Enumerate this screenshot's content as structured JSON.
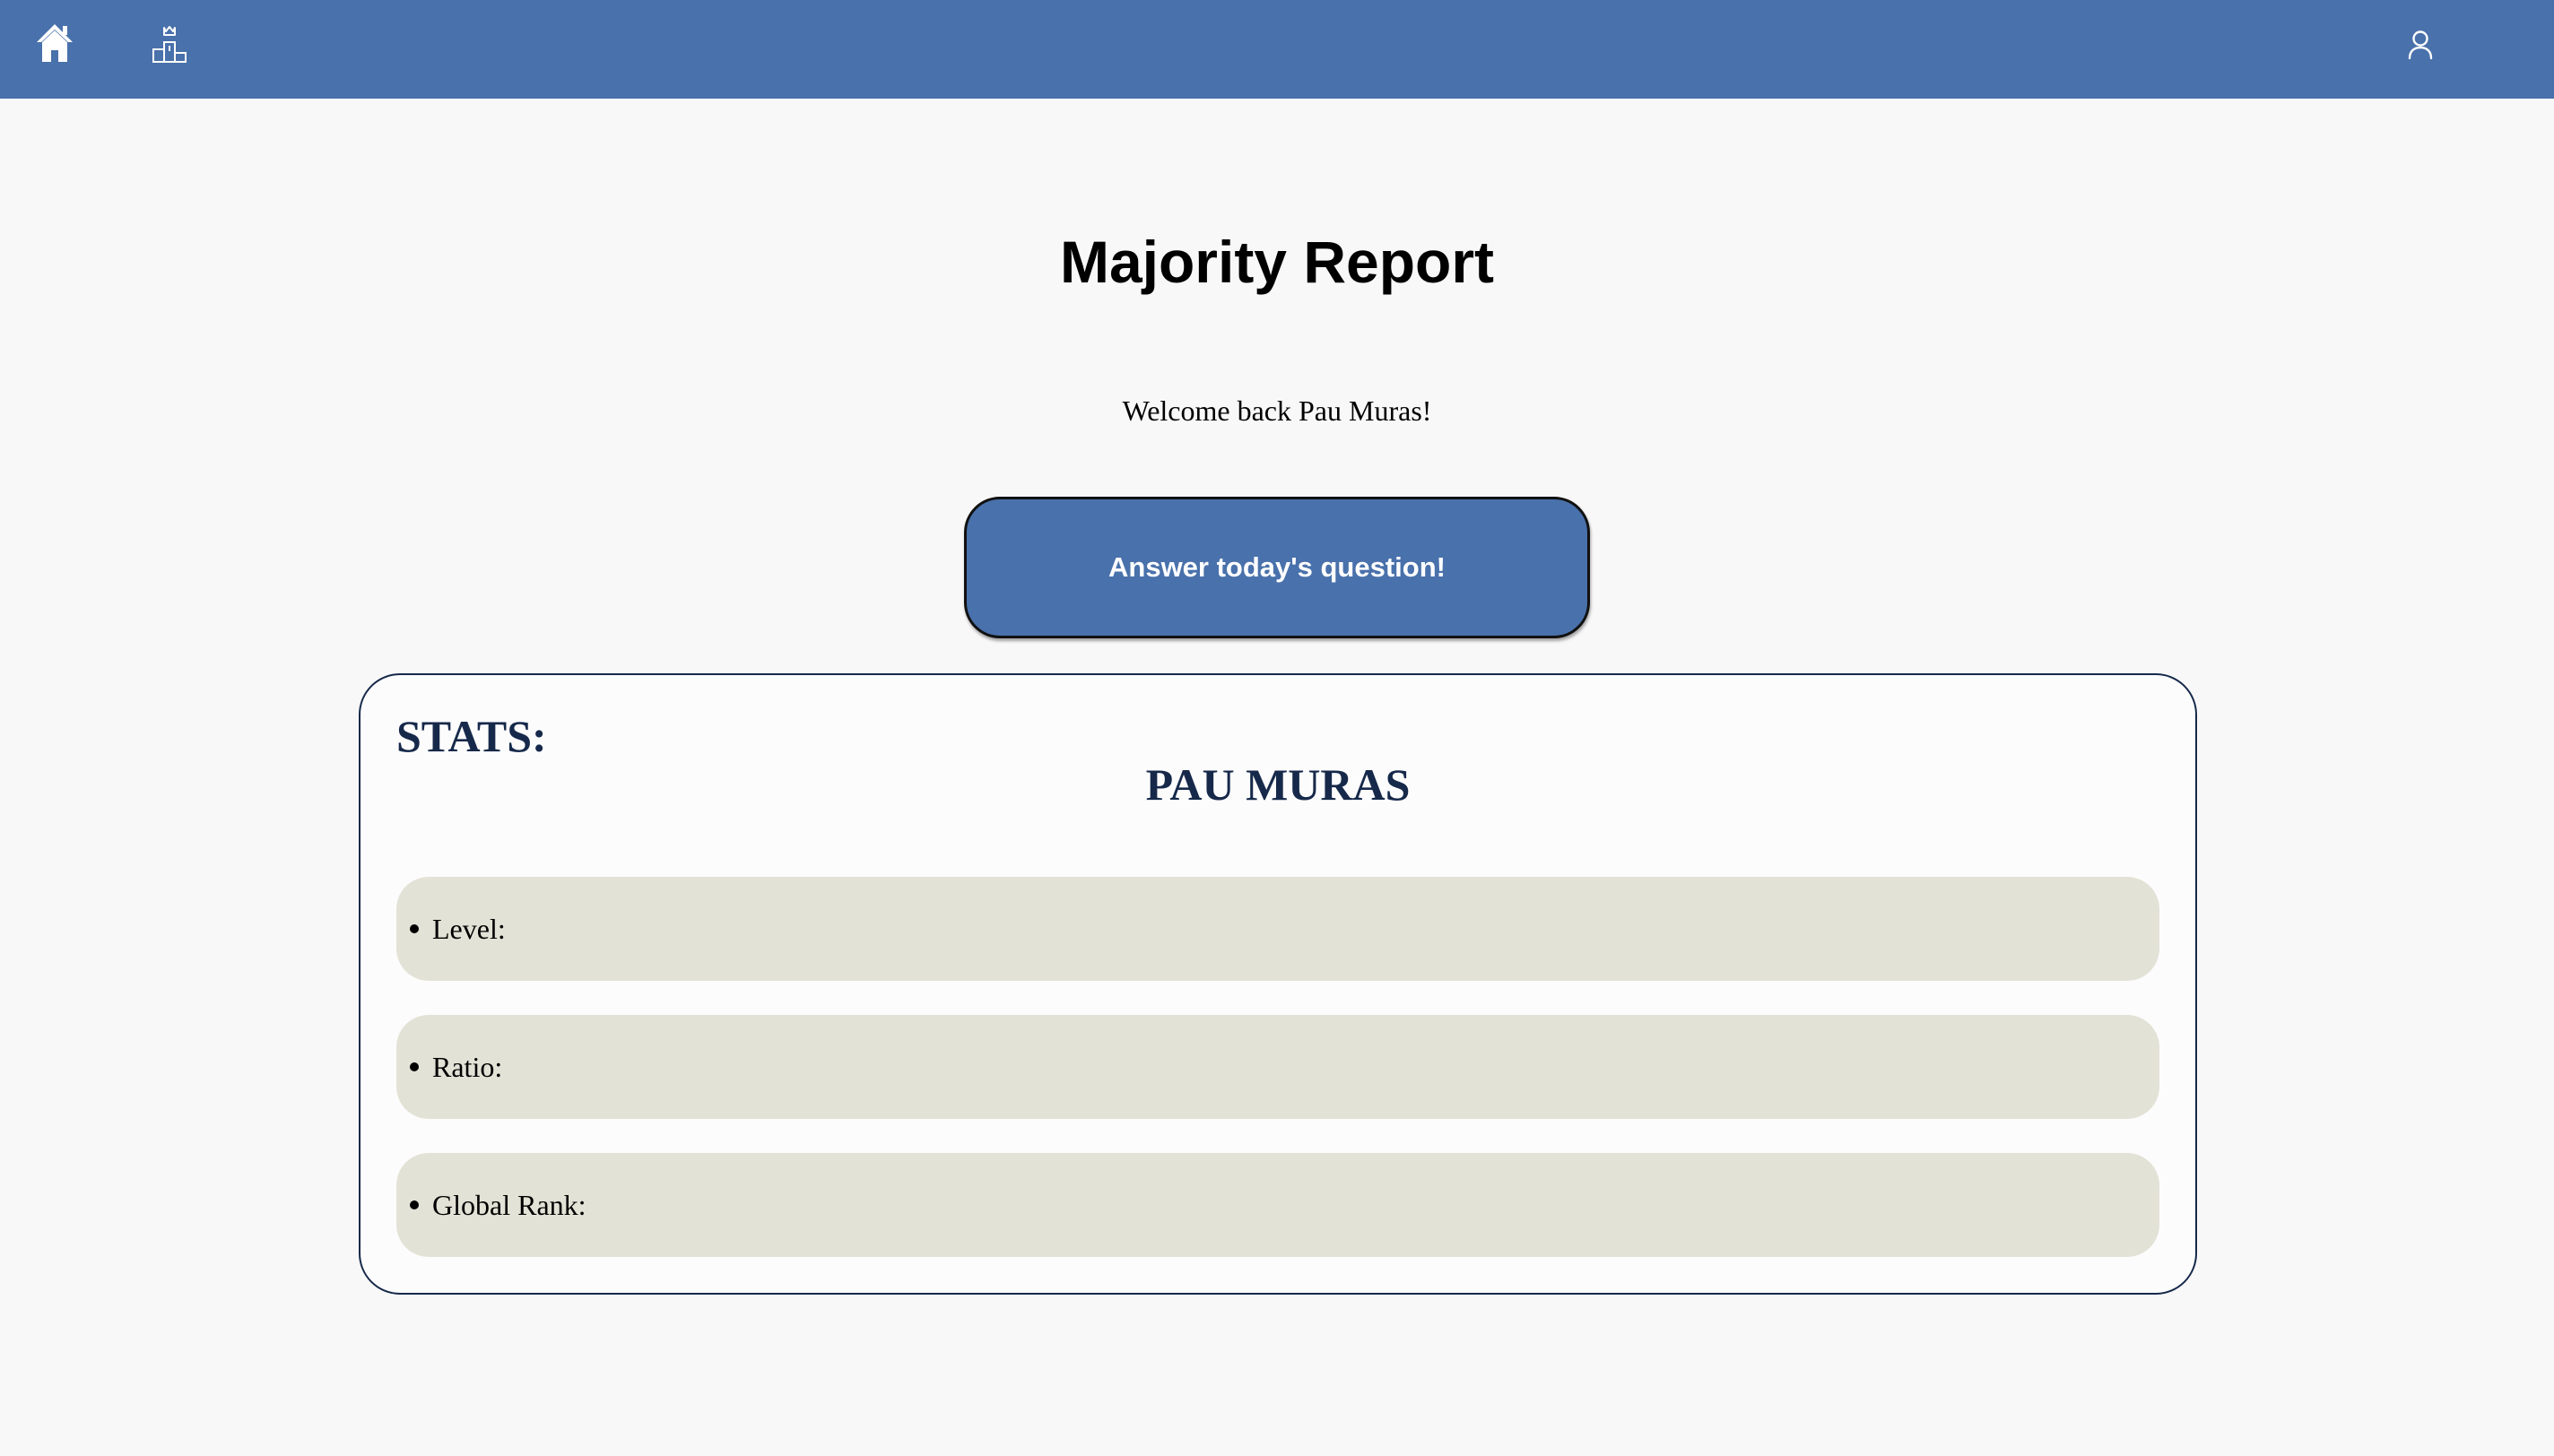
{
  "nav": {
    "icons": [
      "home-icon",
      "leaderboard-icon",
      "user-profile-icon"
    ],
    "background_color": "#4971ab",
    "icon_color": "#ffffff"
  },
  "main": {
    "title": "Majority Report",
    "welcome_text": "Welcome back Pau Muras!",
    "cta_label": "Answer today's question!",
    "cta_color": "#4971ab"
  },
  "stats": {
    "heading": "STATS:",
    "player_name": "PAU MURAS",
    "items": [
      {
        "label": "Level:"
      },
      {
        "label": "Ratio:"
      },
      {
        "label": "Global Rank:"
      }
    ],
    "heading_color": "#16294a",
    "row_color": "#e3e2d6"
  }
}
